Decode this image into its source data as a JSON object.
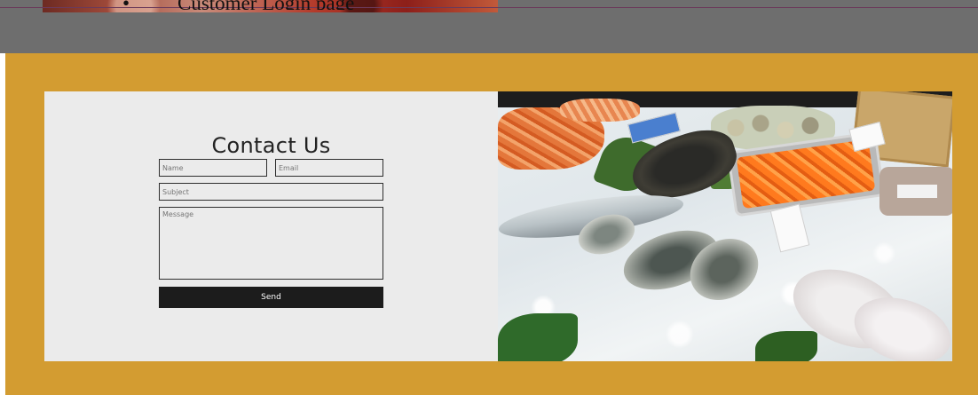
{
  "top_caption": {
    "bullet": "•",
    "text": "Customer Login page"
  },
  "contact_form": {
    "title": "Contact Us",
    "name_placeholder": "Name",
    "email_placeholder": "Email",
    "subject_placeholder": "Subject",
    "message_placeholder": "Message",
    "send_label": "Send"
  },
  "colors": {
    "gold_background": "#d39c31",
    "top_band": "#6e6e6e",
    "form_panel": "#ebebeb",
    "send_button": "#1c1c1c"
  }
}
